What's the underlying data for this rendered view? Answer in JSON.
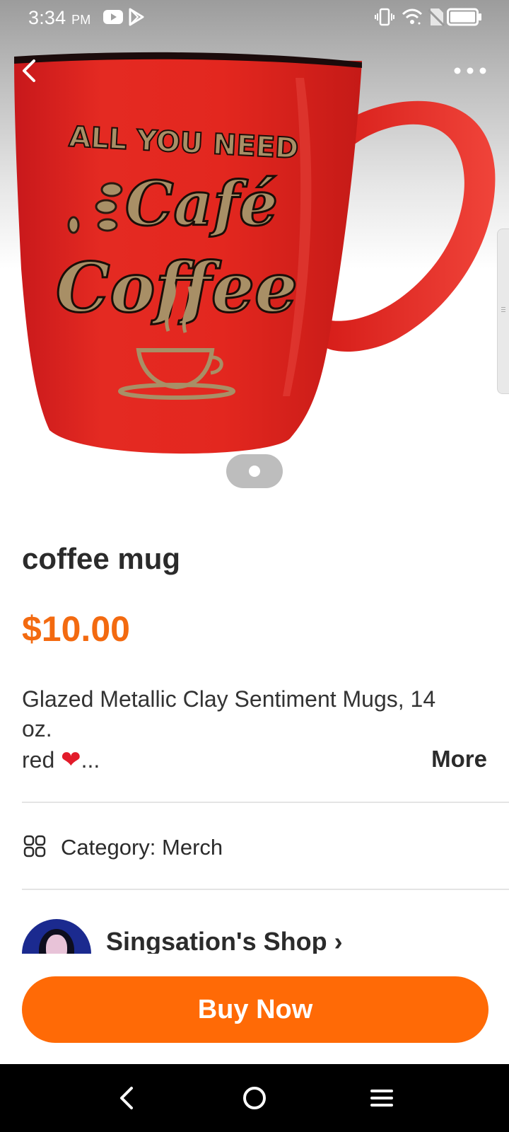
{
  "status_bar": {
    "time": "3:34",
    "ampm": "PM"
  },
  "hero": {
    "image_description": "Red coffee mug with gold lettering",
    "mug_text_line1": "ALL YOU NEED",
    "mug_text_line2": "Café",
    "mug_text_line3": "Coffee",
    "page_indicator": {
      "current": 1,
      "total": 1
    }
  },
  "product": {
    "title": "coffee mug",
    "price": "$10.00",
    "description_line1": "Glazed Metallic Clay Sentiment Mugs, 14",
    "description_line2": "oz.",
    "description_line3_text": "red ",
    "description_line3_suffix": "...",
    "more_label": "More",
    "category_label": "Category: Merch"
  },
  "shop": {
    "name": "Singsation's Shop ›"
  },
  "actions": {
    "buy_label": "Buy Now"
  },
  "colors": {
    "accent": "#ff6a06",
    "price": "#f36a10",
    "mug_red": "#e0261f",
    "mug_gold": "#a88f66"
  },
  "icons": {
    "status": [
      "youtube-icon",
      "play-store-icon",
      "vibrate-icon",
      "wifi-icon",
      "no-sim-icon",
      "battery-icon"
    ],
    "nav": [
      "back-icon",
      "home-icon",
      "menu-icon"
    ]
  }
}
